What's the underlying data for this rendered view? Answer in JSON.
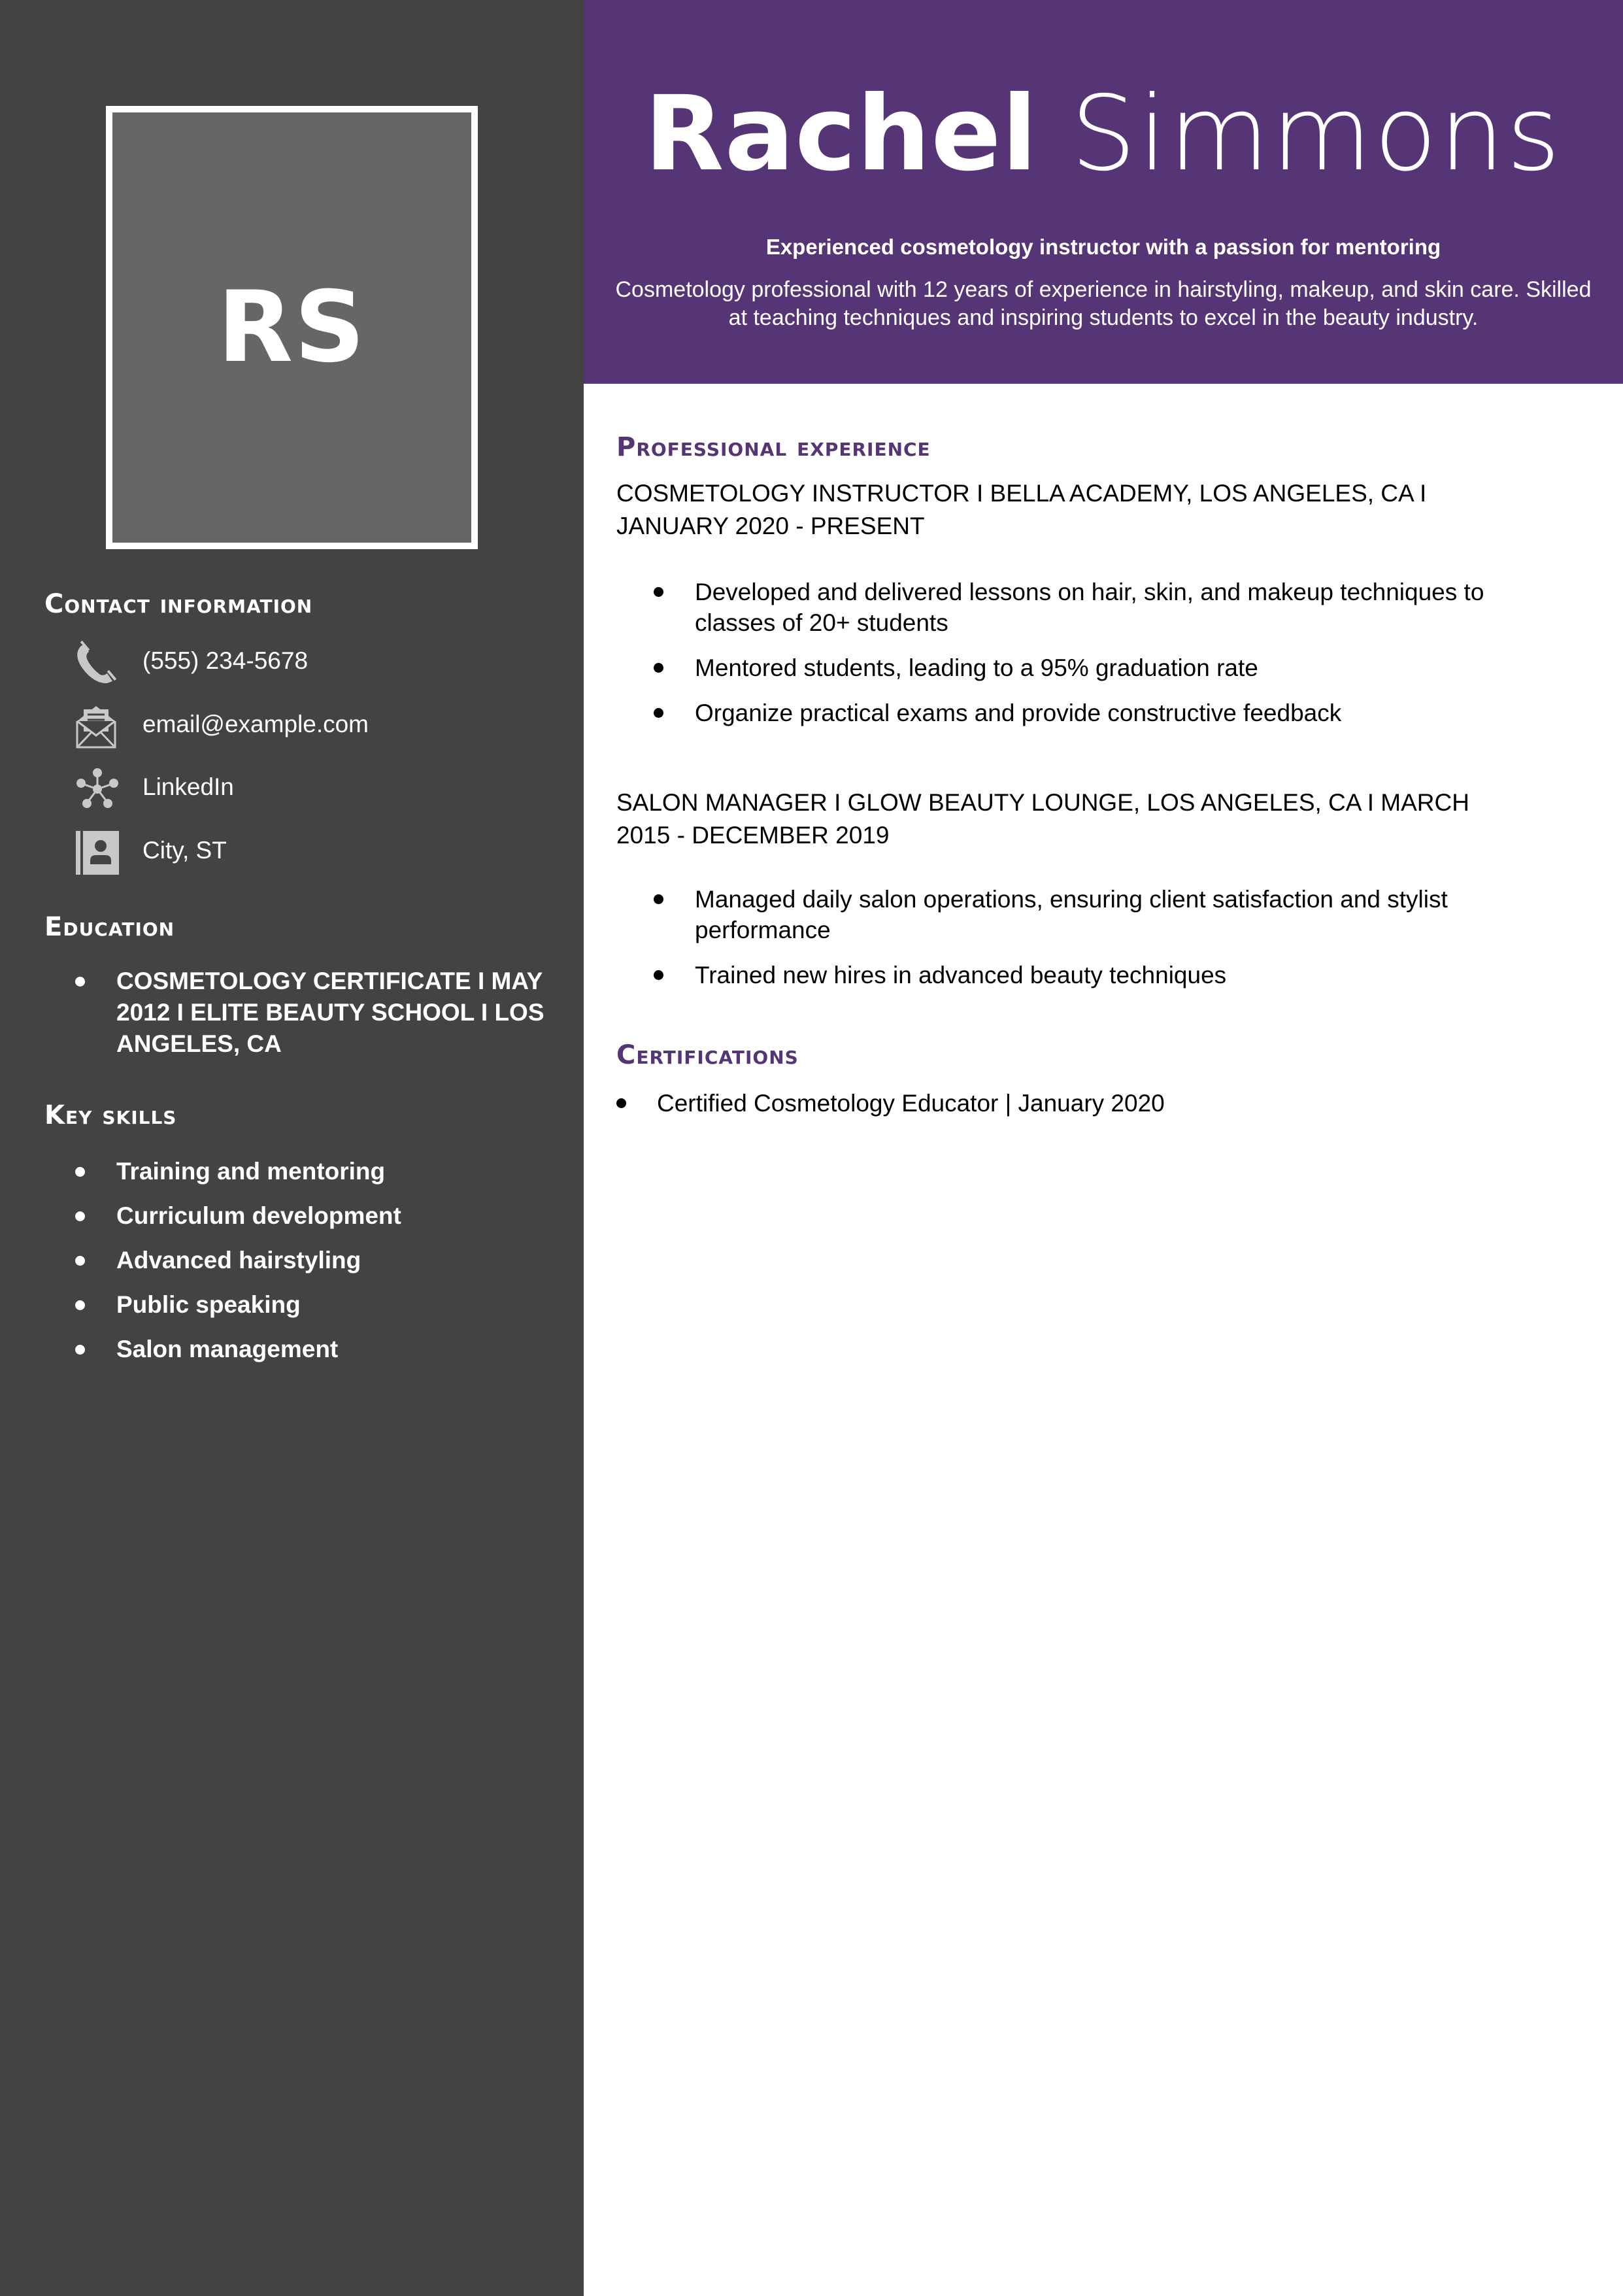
{
  "profile": {
    "initials": "RS",
    "first_name": "Rachel",
    "last_name": "Simmons",
    "tagline": "Experienced cosmetology instructor with a passion for mentoring",
    "summary": "Cosmetology professional with 12 years of experience in hairstyling, makeup, and skin care. Skilled at teaching techniques and inspiring students to excel in the beauty industry."
  },
  "colors": {
    "accent": "#553575",
    "sidebar": "#434343",
    "photo_fill": "#666666",
    "icon": "#c8c8c8"
  },
  "sidebar": {
    "contact": {
      "heading": "Contact information",
      "items": [
        {
          "icon": "phone-icon",
          "text": "(555) 234-5678"
        },
        {
          "icon": "email-icon",
          "text": "email@example.com"
        },
        {
          "icon": "network-icon",
          "text": "LinkedIn"
        },
        {
          "icon": "contact-card-icon",
          "text": "City, ST"
        }
      ]
    },
    "education": {
      "heading": "Education",
      "items": [
        "Cosmetology Certificate I May 2012 I Elite Beauty School I Los Angeles, CA"
      ]
    },
    "skills": {
      "heading": "Key skills",
      "items": [
        "Training and mentoring",
        "Curriculum development",
        "Advanced hairstyling",
        "Public speaking",
        "Salon management"
      ]
    }
  },
  "main": {
    "experience": {
      "heading": "Professional experience",
      "jobs": [
        {
          "title": "Cosmetology Instructor I Bella Academy, Los Angeles, CA I January 2020 - Present",
          "bullets": [
            "Developed and delivered lessons on hair, skin, and makeup techniques to classes of 20+ students",
            "Mentored students, leading to a 95% graduation rate",
            "Organize practical exams and provide constructive feedback"
          ]
        },
        {
          "title": "Salon Manager I Glow Beauty Lounge, Los Angeles, CA I March 2015 - December 2019",
          "bullets": [
            "Managed daily salon operations, ensuring client satisfaction and stylist performance",
            "Trained new hires in advanced beauty techniques"
          ]
        }
      ]
    },
    "certifications": {
      "heading": "Certifications",
      "items": [
        "Certified Cosmetology Educator | January 2020"
      ]
    }
  }
}
